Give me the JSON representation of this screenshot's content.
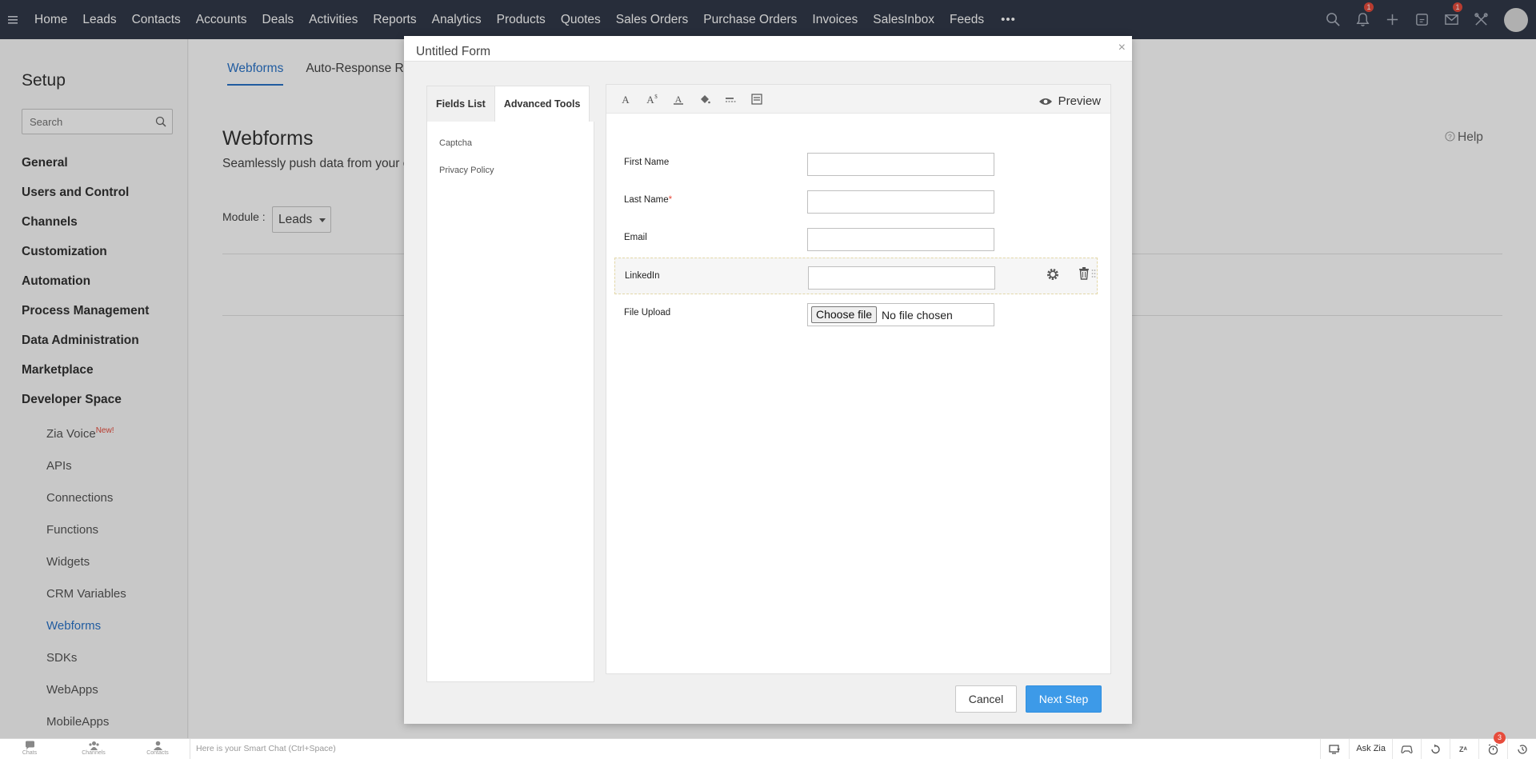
{
  "nav": {
    "items": [
      "Home",
      "Leads",
      "Contacts",
      "Accounts",
      "Deals",
      "Activities",
      "Reports",
      "Analytics",
      "Products",
      "Quotes",
      "Sales Orders",
      "Purchase Orders",
      "Invoices",
      "SalesInbox",
      "Feeds"
    ],
    "more": "•••",
    "notification_count": "1",
    "mail_count": "1"
  },
  "sidebar": {
    "title": "Setup",
    "search_placeholder": "Search",
    "items": [
      "General",
      "Users and Control",
      "Channels",
      "Customization",
      "Automation",
      "Process Management",
      "Data Administration",
      "Marketplace",
      "Developer Space"
    ],
    "subitems": [
      "Zia Voice",
      "APIs",
      "Connections",
      "Functions",
      "Widgets",
      "CRM Variables",
      "Webforms",
      "SDKs",
      "WebApps",
      "MobileApps"
    ],
    "new_tag": "New!",
    "active_subitem": "Webforms"
  },
  "main": {
    "tabs": [
      "Webforms",
      "Auto-Response Ru"
    ],
    "title": "Webforms",
    "description": "Seamlessly push data from your cu",
    "help": "Help",
    "module_label": "Module :",
    "module_value": "Leads"
  },
  "modal": {
    "title": "Untitled Form",
    "close": "×",
    "left_tabs": [
      "Fields List",
      "Advanced Tools"
    ],
    "active_left_tab": "Advanced Tools",
    "tools": [
      "Captcha",
      "Privacy Policy"
    ],
    "preview_label": "Preview",
    "fields": [
      {
        "label": "First Name",
        "required": false
      },
      {
        "label": "Last Name",
        "required": true
      },
      {
        "label": "Email",
        "required": false
      },
      {
        "label": "LinkedIn",
        "required": false
      },
      {
        "label": "File Upload",
        "required": false
      }
    ],
    "required_mark": "*",
    "file_button": "Choose file",
    "file_status": "No file chosen",
    "cancel_label": "Cancel",
    "next_label": "Next Step"
  },
  "bottombar": {
    "items": [
      "Chats",
      "Channels",
      "Contacts"
    ],
    "chat_placeholder": "Here is your Smart Chat (Ctrl+Space)",
    "ask_zia": "Ask Zia",
    "reminder_count": "3"
  },
  "colors": {
    "topbar": "#313949",
    "accent": "#2a74c9",
    "primary_button": "#3d9ae8",
    "badge": "#e74c3c"
  }
}
